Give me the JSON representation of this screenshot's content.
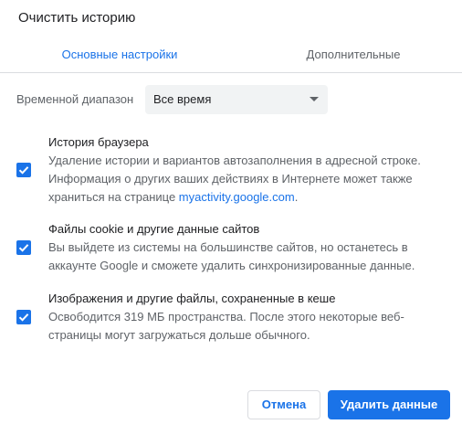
{
  "dialog": {
    "title": "Очистить историю"
  },
  "tabs": [
    {
      "label": "Основные настройки",
      "active": true
    },
    {
      "label": "Дополнительные",
      "active": false
    }
  ],
  "time_range": {
    "label": "Временной диапазон",
    "selected": "Все время"
  },
  "options": [
    {
      "title": "История браузера",
      "checked": true,
      "description_before_link": "Удаление истории и вариантов автозаполнения в адресной строке. Информация о других ваших действиях в Интернете может также храниться на странице ",
      "link_text": "myactivity.google.com",
      "description_after_link": "."
    },
    {
      "title": "Файлы cookie и другие данные сайтов",
      "checked": true,
      "description": "Вы выйдете из системы на большинстве сайтов, но останетесь в аккаунте Google и сможете удалить синхронизированные данные."
    },
    {
      "title": "Изображения и другие файлы, сохраненные в кеше",
      "checked": true,
      "description": "Освободится 319 МБ пространства. После этого некоторые веб-страницы могут загружаться дольше обычного."
    }
  ],
  "buttons": {
    "cancel": "Отмена",
    "clear": "Удалить данные"
  },
  "colors": {
    "accent": "#1a73e8",
    "select_bg": "#f1f3f4",
    "divider": "#dadce0"
  }
}
